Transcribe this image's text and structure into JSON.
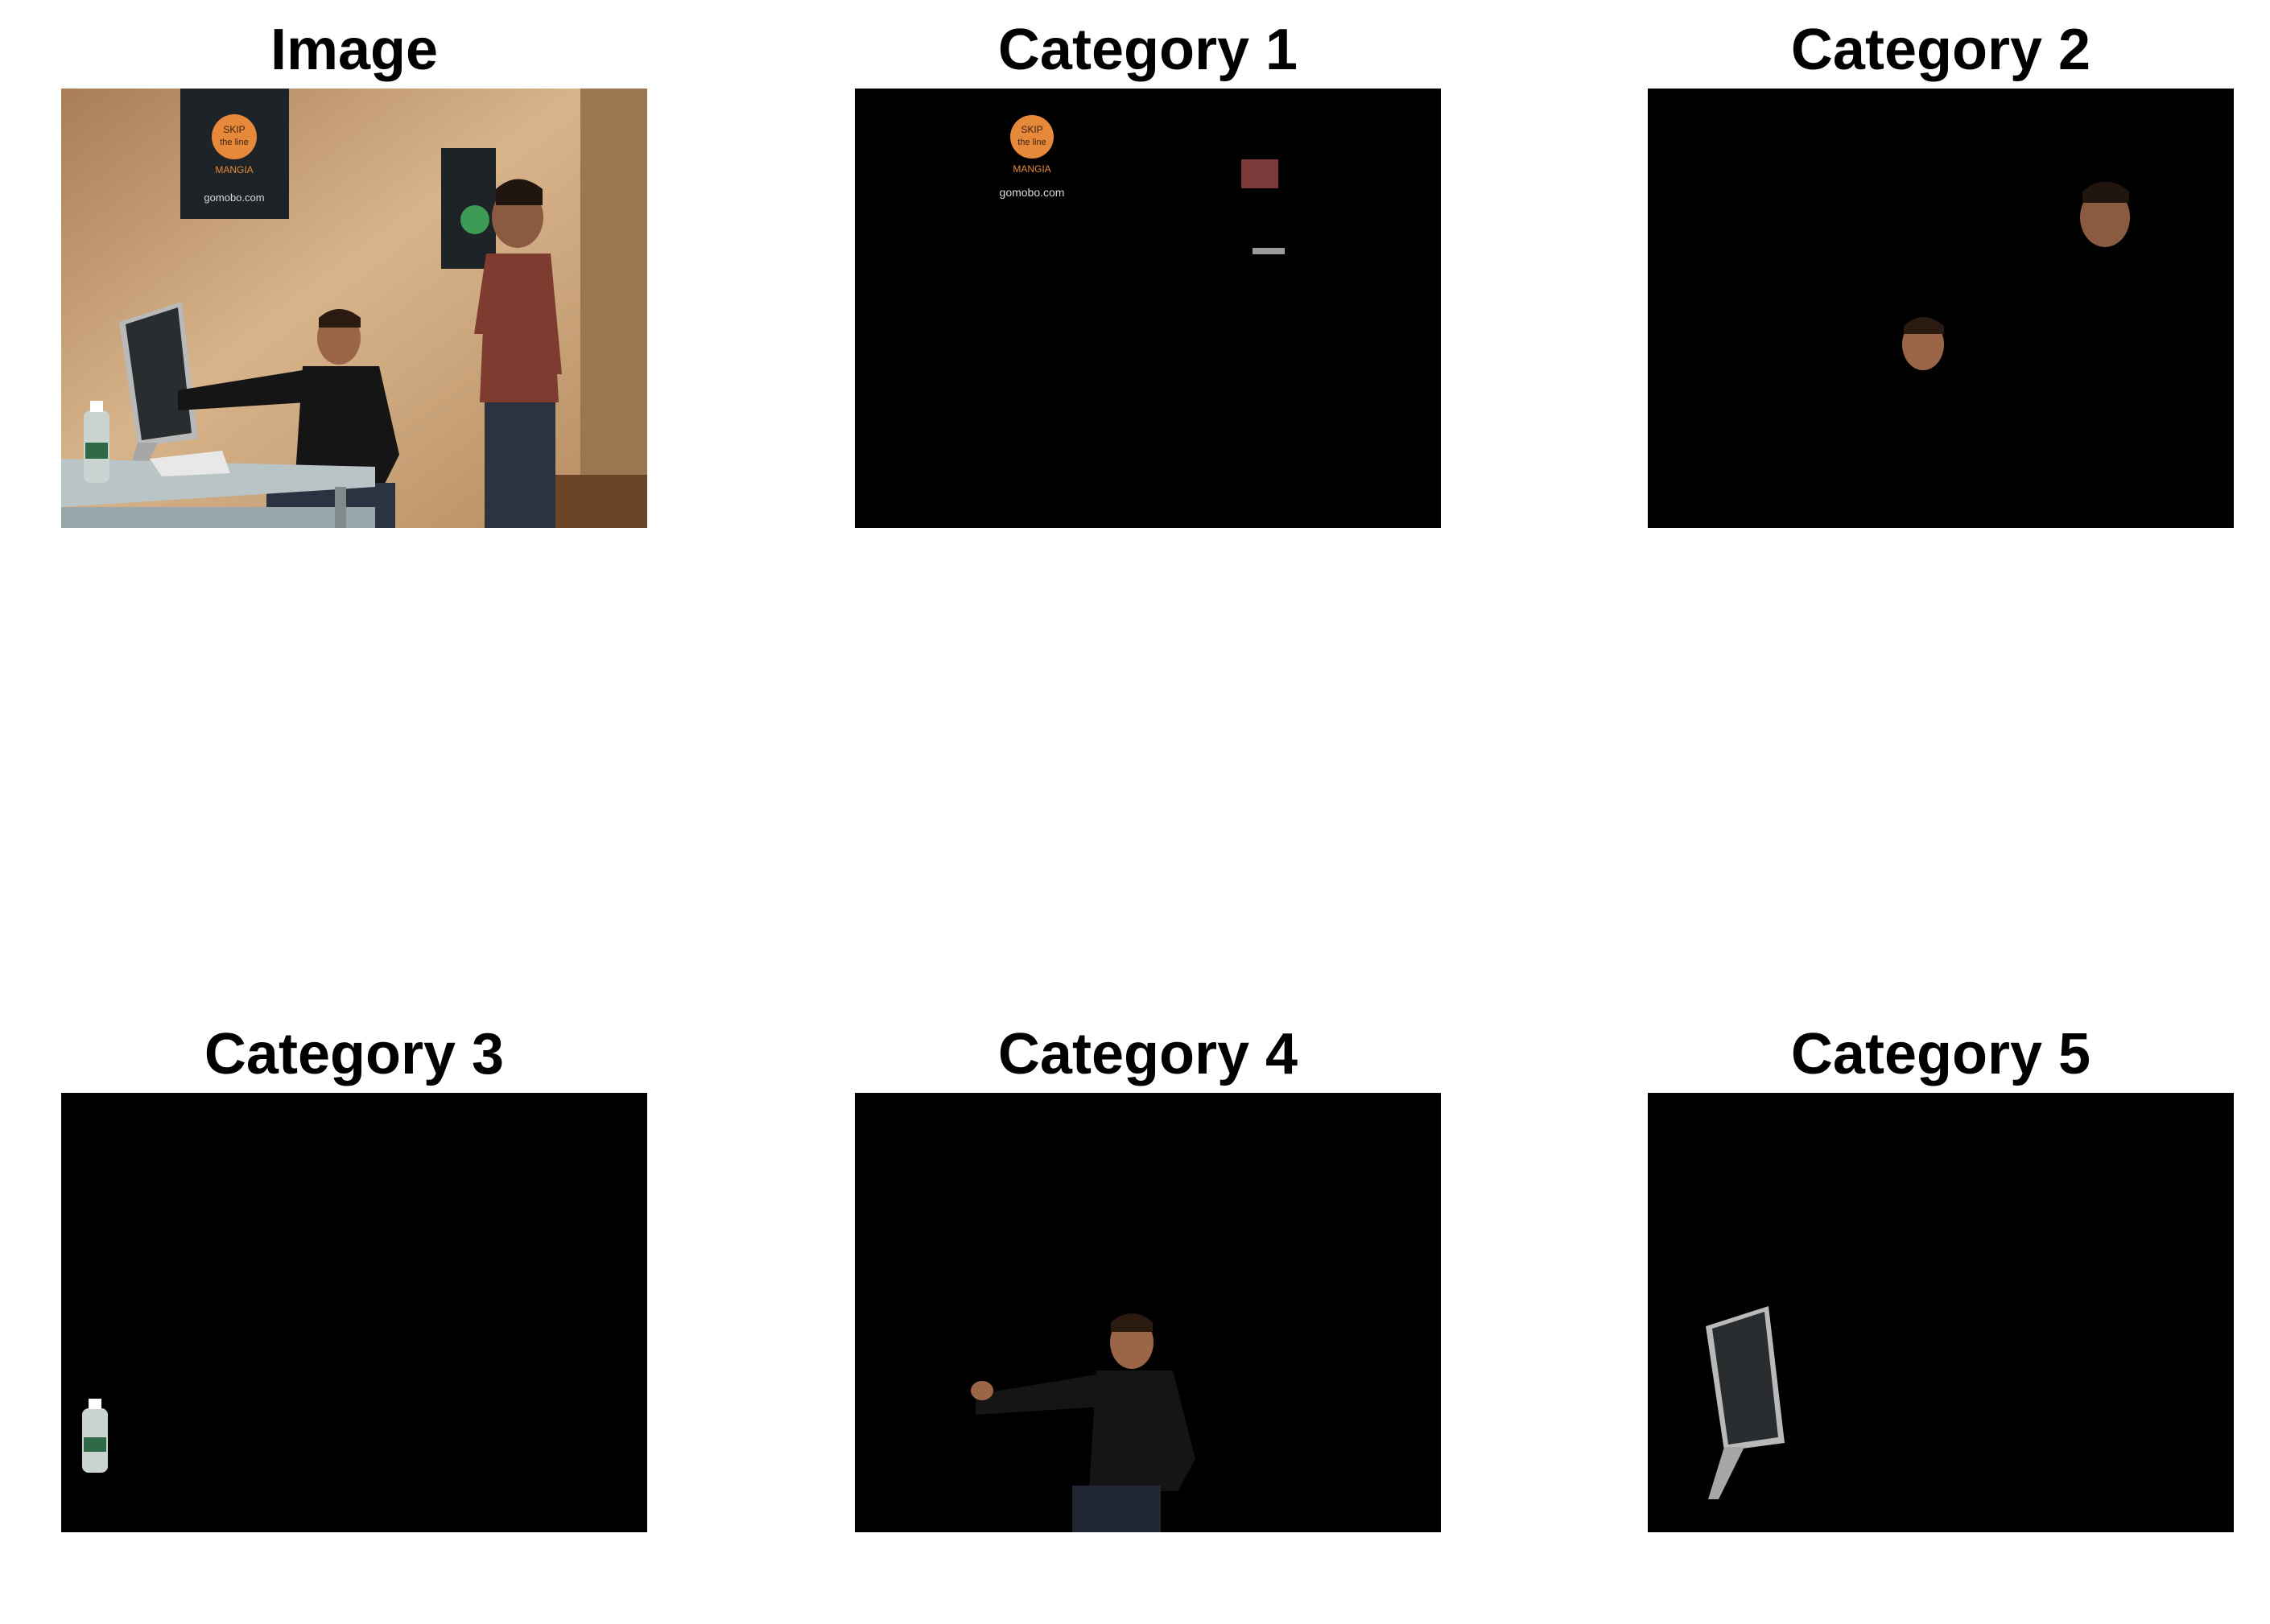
{
  "figure": {
    "panels": [
      {
        "title": "Image"
      },
      {
        "title": "Category 1"
      },
      {
        "title": "Category 2"
      },
      {
        "title": "Category 3"
      },
      {
        "title": "Category 4"
      },
      {
        "title": "Category 5"
      }
    ]
  },
  "poster_text": {
    "line1": "SKIP",
    "line2": "the line",
    "line3": "MANGIA",
    "site": "gomobo.com"
  },
  "colors": {
    "background": "#ffffff",
    "mask": "#000000",
    "wall": "#c9a27a",
    "poster_dot": "#e7893a",
    "poster_green_dot": "#3e9b55"
  }
}
